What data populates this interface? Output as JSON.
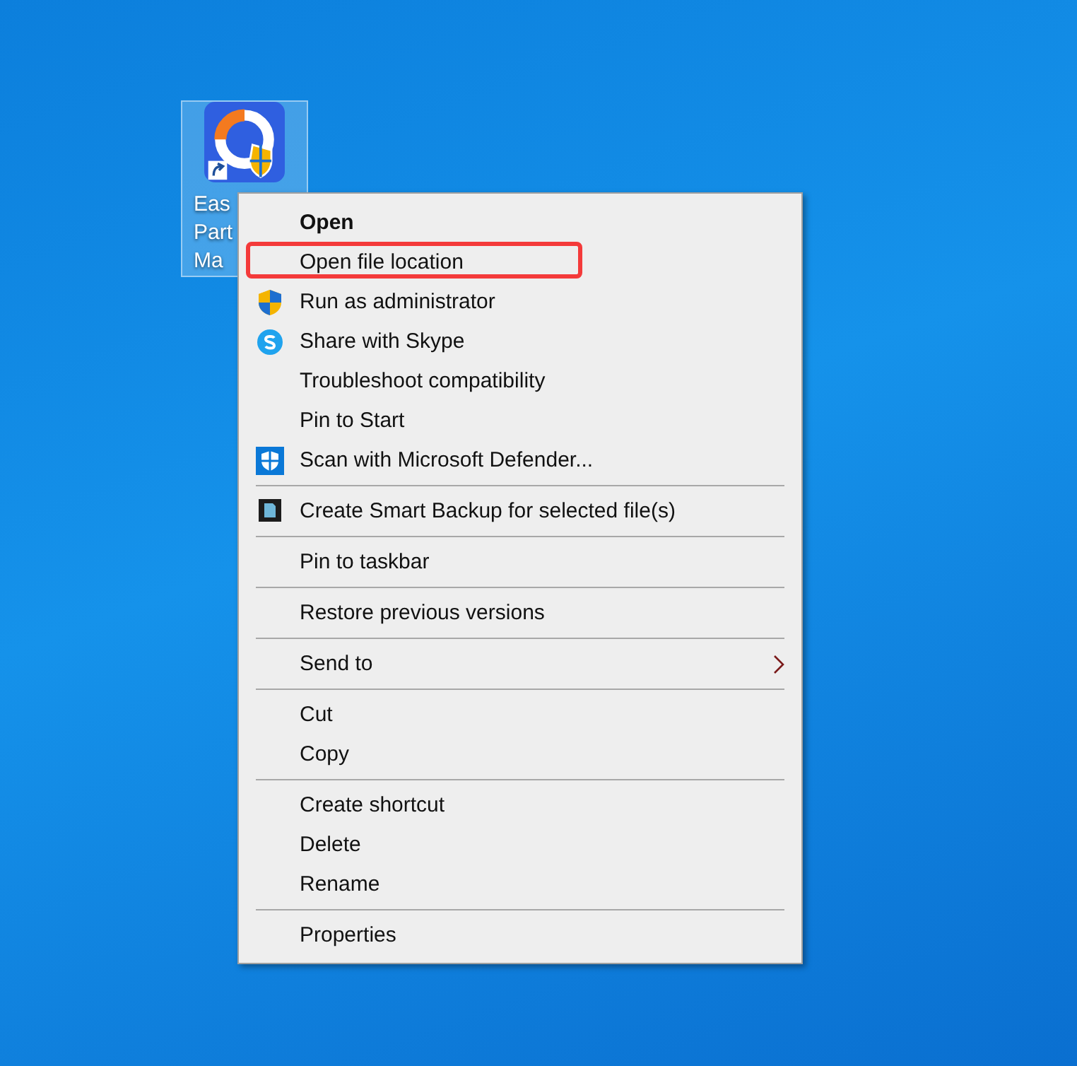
{
  "desktop_icon": {
    "label_lines": [
      "Eas",
      "Part",
      "Ma"
    ],
    "selected": true
  },
  "context_menu": {
    "items": [
      {
        "kind": "default",
        "label": "Open",
        "highlighted": false
      },
      {
        "kind": "plain",
        "label": "Open file location",
        "highlighted": true
      },
      {
        "kind": "admin",
        "label": "Run as administrator",
        "highlighted": false
      },
      {
        "kind": "share",
        "label": "Share with Skype",
        "highlighted": false
      },
      {
        "kind": "plain",
        "label": "Troubleshoot compatibility",
        "highlighted": false
      },
      {
        "kind": "plain",
        "label": "Pin to Start",
        "highlighted": false
      },
      {
        "kind": "scan",
        "label": "Scan with Microsoft Defender...",
        "highlighted": false
      },
      {
        "kind": "separator"
      },
      {
        "kind": "backup",
        "label": "Create Smart Backup for selected file(s)",
        "highlighted": false
      },
      {
        "kind": "separator"
      },
      {
        "kind": "plain",
        "label": "Pin to taskbar",
        "highlighted": false
      },
      {
        "kind": "separator"
      },
      {
        "kind": "plain",
        "label": "Restore previous versions",
        "highlighted": false
      },
      {
        "kind": "separator"
      },
      {
        "kind": "submenu",
        "label": "Send to",
        "highlighted": false
      },
      {
        "kind": "separator"
      },
      {
        "kind": "plain",
        "label": "Cut",
        "highlighted": false
      },
      {
        "kind": "plain",
        "label": "Copy",
        "highlighted": false
      },
      {
        "kind": "separator"
      },
      {
        "kind": "plain",
        "label": "Create shortcut",
        "highlighted": false
      },
      {
        "kind": "plain",
        "label": "Delete",
        "highlighted": false
      },
      {
        "kind": "plain",
        "label": "Rename",
        "highlighted": false
      },
      {
        "kind": "separator"
      },
      {
        "kind": "plain",
        "label": "Properties",
        "highlighted": false
      }
    ]
  }
}
